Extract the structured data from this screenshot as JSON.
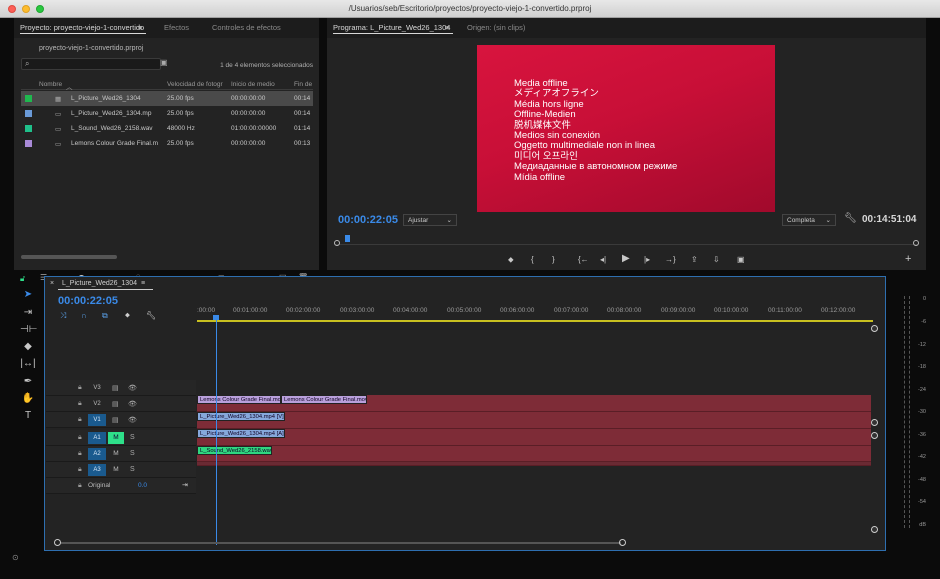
{
  "window": {
    "title": "/Usuarios/seb/Escritorio/proyectos/proyecto-viejo-1-convertido.prproj"
  },
  "project_panel": {
    "tabs": [
      "Proyecto: proyecto-viejo-1-convertido",
      "Efectos",
      "Controles de efectos"
    ],
    "file_name": "proyecto-viejo-1-convertido.prproj",
    "search_placeholder": "",
    "selection_count": "1 de 4 elementos seleccionados",
    "columns": [
      "Nombre",
      "Velocidad de fotogr",
      "Inicio de medio",
      "Fin de"
    ],
    "rows": [
      {
        "name": "L_Picture_Wed26_1304",
        "fps": "25.00 fps",
        "start": "00:00:00:00",
        "end": "00:14",
        "color": "#1fb84f",
        "selected": true
      },
      {
        "name": "L_Picture_Wed26_1304.mp",
        "fps": "25.00 fps",
        "start": "00:00:00:00",
        "end": "00:14",
        "color": "#6a9ad8",
        "selected": false
      },
      {
        "name": "L_Sound_Wed26_2158.wav",
        "fps": "48000 Hz",
        "start": "01:00:00:00000",
        "end": "01:14",
        "color": "#1fc08a",
        "selected": false
      },
      {
        "name": "Lemons Colour Grade Final.m",
        "fps": "25.00 fps",
        "start": "00:00:00:00",
        "end": "00:13",
        "color": "#a98ad8",
        "selected": false
      }
    ]
  },
  "program_monitor": {
    "tabs": [
      "Programa: L_Picture_Wed26_1304",
      "Origen: (sin clips)"
    ],
    "offline_messages": [
      "Media offline",
      "メディアオフライン",
      "Média hors ligne",
      "Offline-Medien",
      "脱机媒体文件",
      "Medios sin conexión",
      "Oggetto multimediale non in linea",
      "미디어 오프라인",
      "Медиаданные в автономном режиме",
      "Mídia offline"
    ],
    "timecode": "00:00:22:05",
    "fit_label": "Ajustar",
    "quality_label": "Completa",
    "duration": "00:14:51:04"
  },
  "timeline": {
    "sequence_tab": "L_Picture_Wed26_1304",
    "timecode": "00:00:22:05",
    "ruler_ticks": [
      ":00:00",
      "00:01:00:00",
      "00:02:00:00",
      "00:03:00:00",
      "00:04:00:00",
      "00:05:00:00",
      "00:06:00:00",
      "00:07:00:00",
      "00:08:00:00",
      "00:09:00:00",
      "00:10:00:00",
      "00:11:00:00",
      "00:12:00:00"
    ],
    "tracks": {
      "v3": "V3",
      "v2": "V2",
      "v1": "V1",
      "a1": "A1",
      "a2": "A2",
      "a3": "A3",
      "master": "Original",
      "master_value": "0.0"
    },
    "clips": {
      "v3_a": "Lemons Colour Grade Final.mo",
      "v3_b": "Lemons Colour Grade Final.mov",
      "v1": "L_Picture_Wed26_1304.mp4 [V]",
      "a1": "L_Picture_Wed26_1304.mp4 [A]",
      "a2": "L_Sound_Wed26_2158.wav"
    }
  },
  "meter": {
    "labels": [
      "0",
      "-6",
      "-12",
      "-18",
      "-24",
      "-30",
      "-36",
      "-42",
      "-48",
      "-54",
      "dB"
    ]
  },
  "colors": {
    "accent": "#3a8ae8",
    "track_bg": "#7e2c37",
    "selection_green": "#2ee08a"
  }
}
